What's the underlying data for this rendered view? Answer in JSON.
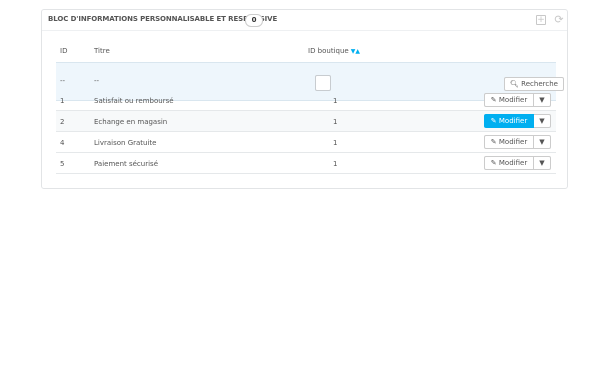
{
  "panel": {
    "title": "BLOC D'INFORMATIONS PERSONNALISABLE ET RESPONSIVE",
    "count": "0",
    "add_icon": "plus-square-icon",
    "refresh_icon": "refresh-icon"
  },
  "table": {
    "columns": {
      "id": "ID",
      "title": "Titre",
      "shop": "ID boutique"
    },
    "sort_icon": "sort-arrows-icon",
    "filter": {
      "id": "--",
      "title": "--",
      "search_label": "Recherche",
      "search_icon": "search-icon"
    },
    "rows": [
      {
        "id": "1",
        "title": "Satisfait ou remboursé",
        "shop": "1",
        "action": "Modifier"
      },
      {
        "id": "2",
        "title": "Echange en magasin",
        "shop": "1",
        "action": "Modifier"
      },
      {
        "id": "4",
        "title": "Livraison Gratuite",
        "shop": "1",
        "action": "Modifier"
      },
      {
        "id": "5",
        "title": "Paiement sécurisé",
        "shop": "1",
        "action": "Modifier"
      }
    ],
    "edit_icon": "pencil-icon",
    "caret_icon": "caret-down-icon",
    "colors": {
      "active_button": "#00aff0",
      "sort_arrow": "#00aff0"
    }
  }
}
